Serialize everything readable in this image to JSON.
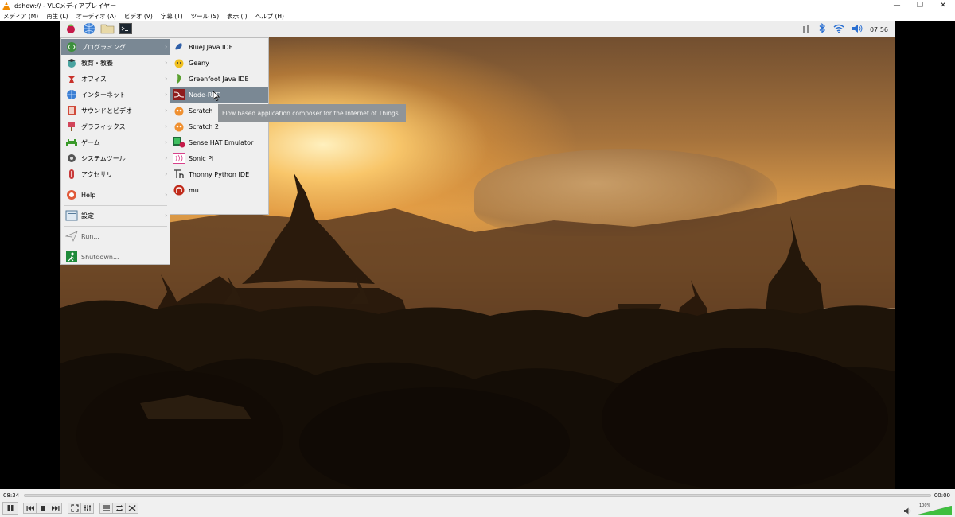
{
  "window": {
    "title": "dshow:// - VLCメディアプレイヤー",
    "controls": [
      "minimize",
      "restore",
      "close"
    ]
  },
  "menubar": {
    "items": [
      "メディア (M)",
      "再生 (L)",
      "オーディオ (A)",
      "ビデオ (V)",
      "字幕 (T)",
      "ツール (S)",
      "表示 (I)",
      "ヘルプ (H)"
    ]
  },
  "pi_panel": {
    "launchers": [
      "raspberry-menu-icon",
      "web-browser-icon",
      "file-manager-icon",
      "terminal-icon"
    ],
    "tray_icons": [
      "network-icon",
      "bluetooth-icon",
      "wifi-icon",
      "volume-icon"
    ],
    "clock": "07:56"
  },
  "main_menu": {
    "items": [
      {
        "label": "プログラミング",
        "icon": "programming-icon",
        "submenu": true,
        "selected": true
      },
      {
        "label": "教育・教養",
        "icon": "education-icon",
        "submenu": true
      },
      {
        "label": "オフィス",
        "icon": "office-icon",
        "submenu": true
      },
      {
        "label": "インターネット",
        "icon": "internet-icon",
        "submenu": true
      },
      {
        "label": "サウンドとビデオ",
        "icon": "sound-video-icon",
        "submenu": true
      },
      {
        "label": "グラフィックス",
        "icon": "graphics-icon",
        "submenu": true
      },
      {
        "label": "ゲーム",
        "icon": "games-icon",
        "submenu": true
      },
      {
        "label": "システムツール",
        "icon": "system-tools-icon",
        "submenu": true
      },
      {
        "label": "アクセサリ",
        "icon": "accessories-icon",
        "submenu": true
      },
      {
        "label": "Help",
        "icon": "help-icon",
        "submenu": true
      },
      {
        "label": "設定",
        "icon": "settings-icon",
        "submenu": true
      },
      {
        "label": "Run...",
        "icon": "run-icon",
        "submenu": false
      },
      {
        "label": "Shutdown...",
        "icon": "shutdown-icon",
        "submenu": false
      }
    ]
  },
  "programming_submenu": {
    "items": [
      {
        "label": "BlueJ Java IDE",
        "icon": "bluej-icon"
      },
      {
        "label": "Geany",
        "icon": "geany-icon"
      },
      {
        "label": "Greenfoot Java IDE",
        "icon": "greenfoot-icon"
      },
      {
        "label": "Node-RED",
        "icon": "node-red-icon",
        "selected": true
      },
      {
        "label": "Scratch",
        "icon": "scratch-icon"
      },
      {
        "label": "Scratch 2",
        "icon": "scratch2-icon"
      },
      {
        "label": "Sense HAT Emulator",
        "icon": "sense-hat-icon"
      },
      {
        "label": "Sonic Pi",
        "icon": "sonic-pi-icon"
      },
      {
        "label": "Thonny Python IDE",
        "icon": "thonny-icon"
      },
      {
        "label": "mu",
        "icon": "mu-icon"
      }
    ]
  },
  "tooltip": {
    "text": "Flow based application composer for the Internet of Things"
  },
  "player": {
    "elapsed": "08:34",
    "remaining": "00:00",
    "volume_percent": "100%",
    "volume_level": 1.0,
    "buttons": [
      "pause-icon",
      "previous-icon",
      "stop-icon",
      "next-icon",
      "fullscreen-icon",
      "extended-settings-icon",
      "playlist-icon",
      "loop-icon",
      "shuffle-icon"
    ]
  }
}
